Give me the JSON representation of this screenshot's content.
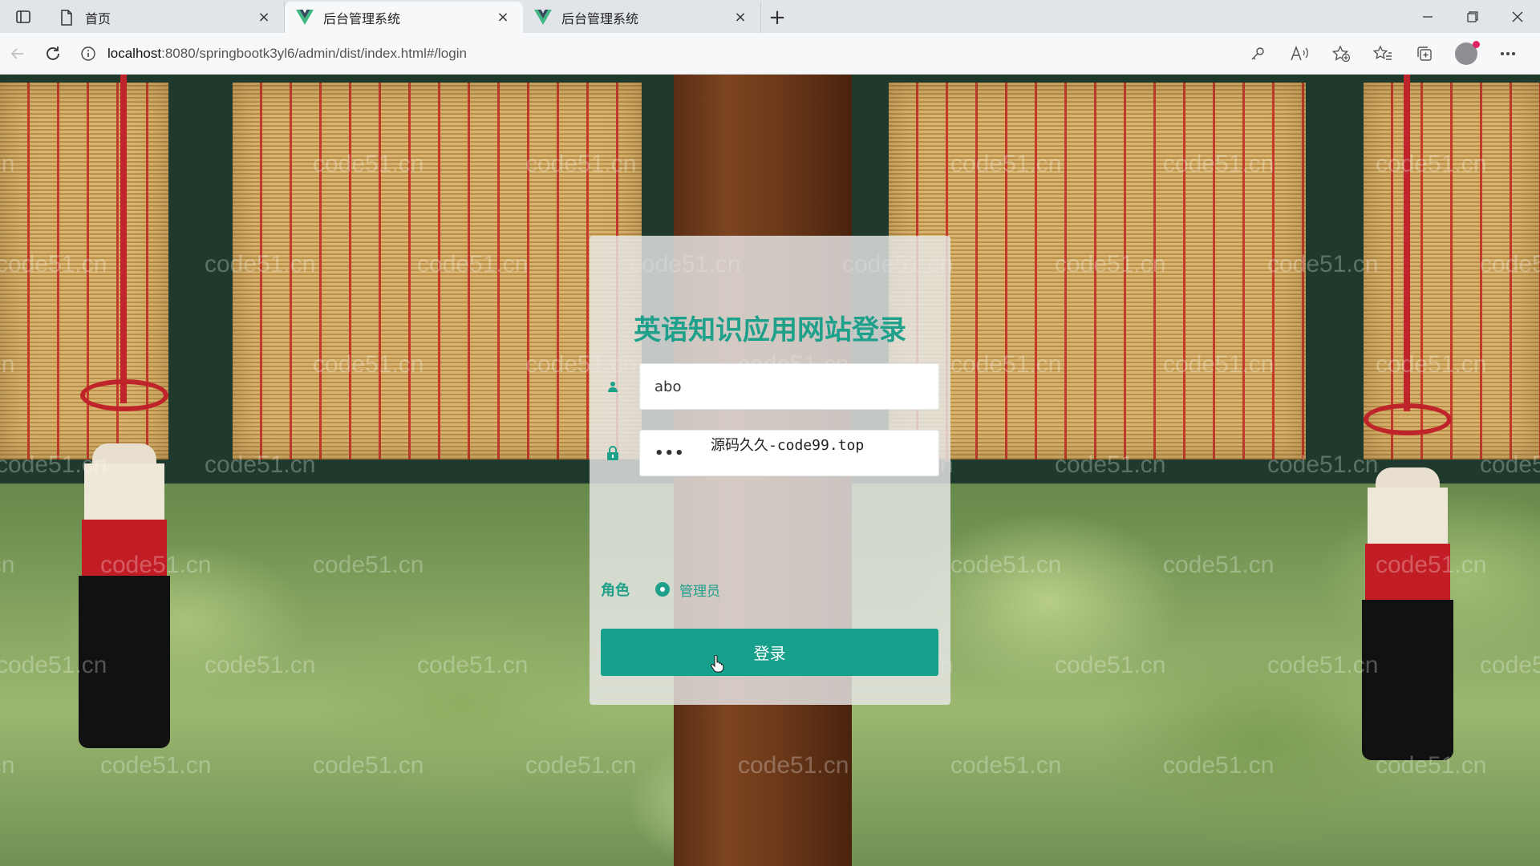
{
  "browser": {
    "tabs": [
      {
        "title": "首页",
        "icon": "page-icon",
        "active": false
      },
      {
        "title": "后台管理系统",
        "icon": "vue-logo-icon",
        "active": true
      },
      {
        "title": "后台管理系统",
        "icon": "vue-logo-icon",
        "active": false
      }
    ],
    "url": {
      "host": "localhost",
      "path": ":8080/springbootk3yl6/admin/dist/index.html#/login"
    },
    "new_tab_symbol": "+",
    "close_symbol": "×"
  },
  "watermark_text": "code51.cn",
  "login": {
    "title": "英语知识应用网站登录",
    "username_value": "abo",
    "password_mask": "•••",
    "overlay_text": "源码久久-code99.top",
    "role_label": "角色",
    "role_option": "管理员",
    "submit_label": "登录"
  },
  "colors": {
    "accent": "#1ea08a",
    "button": "#17a08c"
  }
}
